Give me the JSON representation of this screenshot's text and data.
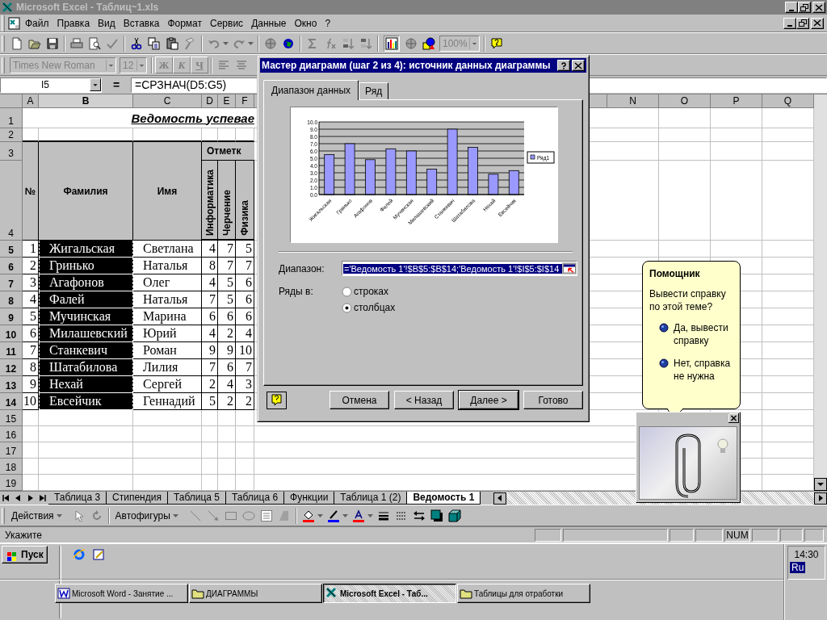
{
  "window": {
    "title": "Microsoft Excel - Таблиц~1.xls"
  },
  "menu": [
    "Файл",
    "Правка",
    "Вид",
    "Вставка",
    "Формат",
    "Сервис",
    "Данные",
    "Окно",
    "?"
  ],
  "standard_toolbar": {
    "zoom": "100%"
  },
  "formatting_toolbar": {
    "font": "Times New Roman",
    "size": "12",
    "style_buttons": [
      "Ж",
      "К",
      "Ч"
    ]
  },
  "formula_bar": {
    "name_box": "I5",
    "equals": "=",
    "formula": "=СРЗНАЧ(D5:G5)"
  },
  "sheet": {
    "columns_left": [
      {
        "label": "A",
        "selected": false
      },
      {
        "label": "B",
        "selected": true
      },
      {
        "label": "C",
        "selected": false
      },
      {
        "label": "D",
        "selected": false
      },
      {
        "label": "E",
        "selected": false
      },
      {
        "label": "F",
        "selected": false
      }
    ],
    "columns_right": [
      {
        "label": "N",
        "selected": false
      },
      {
        "label": "O",
        "selected": false
      },
      {
        "label": "P",
        "selected": false
      },
      {
        "label": "Q",
        "selected": false
      }
    ],
    "title_row": {
      "row": "1",
      "text": "Ведомость успевае"
    },
    "blank_row": "2",
    "header_rows": {
      "rows": [
        "3",
        "4"
      ],
      "number": "№",
      "surname": "Фамилия",
      "name": "Имя",
      "group": "Отметк",
      "subjects": [
        "Информатика",
        "Черчение",
        "Физика"
      ]
    },
    "rows": [
      {
        "row": "5",
        "selected": true,
        "cells": [
          "1",
          "Жигальская",
          "Светлана",
          "4",
          "7",
          "5"
        ]
      },
      {
        "row": "6",
        "selected": true,
        "cells": [
          "2",
          "Гринько",
          "Наталья",
          "8",
          "7",
          "7"
        ]
      },
      {
        "row": "7",
        "selected": true,
        "cells": [
          "3",
          "Агафонов",
          "Олег",
          "4",
          "5",
          "6"
        ]
      },
      {
        "row": "8",
        "selected": true,
        "cells": [
          "4",
          "Фалей",
          "Наталья",
          "7",
          "5",
          "6"
        ]
      },
      {
        "row": "9",
        "selected": true,
        "cells": [
          "5",
          "Мучинская",
          "Марина",
          "6",
          "6",
          "6"
        ]
      },
      {
        "row": "10",
        "selected": true,
        "cells": [
          "6",
          "Милашевский",
          "Юрий",
          "4",
          "2",
          "4"
        ]
      },
      {
        "row": "11",
        "selected": true,
        "cells": [
          "7",
          "Станкевич",
          "Роман",
          "9",
          "9",
          "10"
        ]
      },
      {
        "row": "12",
        "selected": true,
        "cells": [
          "8",
          "Шатабилова",
          "Лилия",
          "7",
          "6",
          "7"
        ]
      },
      {
        "row": "13",
        "selected": true,
        "cells": [
          "9",
          "Нехай",
          "Сергей",
          "2",
          "4",
          "3"
        ]
      },
      {
        "row": "14",
        "selected": true,
        "cells": [
          "10",
          "Евсейчик",
          "Геннадий",
          "5",
          "2",
          "2"
        ]
      }
    ],
    "empty_rows": [
      "15",
      "16",
      "17",
      "18",
      "19"
    ]
  },
  "sheet_tabs": [
    {
      "label": "Таблица 3",
      "selected": false
    },
    {
      "label": "Стипендия",
      "selected": false
    },
    {
      "label": "Таблица 5",
      "selected": false
    },
    {
      "label": "Таблица 6",
      "selected": false
    },
    {
      "label": "Функции",
      "selected": false
    },
    {
      "label": "Таблица 1 (2)",
      "selected": false
    },
    {
      "label": "Ведомость 1",
      "selected": true
    }
  ],
  "drawing_toolbar": {
    "actions": "Действия",
    "autoshapes": "Автофигуры"
  },
  "status_bar": {
    "message": "Укажите",
    "num_lock": "NUM"
  },
  "chart_wizard": {
    "title": "Мастер диаграмм (шаг 2 из 4): источник данных диаграммы",
    "tabs": [
      {
        "label": "Диапазон данных",
        "selected": true
      },
      {
        "label": "Ряд",
        "selected": false
      }
    ],
    "chart_data": {
      "type": "bar",
      "categories": [
        "Жигальская",
        "Гринько",
        "Агафонов",
        "Фалей",
        "Мучинская",
        "Милашевский",
        "Станкевич",
        "Шатабилова",
        "Нехай",
        "Евсейчик"
      ],
      "series": [
        {
          "name": "Ряд1",
          "color": "#9999ff",
          "values": [
            5.5,
            7,
            4.8,
            6.3,
            6,
            3.5,
            9,
            6.5,
            2.8,
            3.3
          ]
        }
      ],
      "grid": true,
      "ylim": [
        0,
        10
      ],
      "yticks": [
        {
          "value": 0,
          "label": "0.0"
        },
        {
          "value": 1,
          "label": "1.0"
        },
        {
          "value": 2,
          "label": "2.0"
        },
        {
          "value": 3,
          "label": "3.0"
        },
        {
          "value": 4,
          "label": "4.0"
        },
        {
          "value": 5,
          "label": "5.0"
        },
        {
          "value": 6,
          "label": "6.0"
        },
        {
          "value": 7,
          "label": "7.0"
        },
        {
          "value": 8,
          "label": "8.0"
        },
        {
          "value": 9,
          "label": "9.0"
        },
        {
          "value": 10,
          "label": "10.0"
        }
      ]
    },
    "range_label": "Диапазон:",
    "range": "='Ведомость 1'!$B$5:$B$14;'Ведомость 1'!$I$5:$I$14",
    "series_in_label": "Ряды в:",
    "series_in": [
      {
        "label": "строках",
        "selected": false
      },
      {
        "label": "столбцах",
        "selected": true
      }
    ],
    "buttons": [
      {
        "label": "Отмена",
        "default": false
      },
      {
        "label": "< Назад",
        "default": false
      },
      {
        "label": "Далее >",
        "default": true
      },
      {
        "label": "Готово",
        "default": false
      }
    ]
  },
  "assistant": {
    "title": "Помощник",
    "question": "Вывести справку по этой теме?",
    "options": [
      "Да, вывести справку",
      "Нет, справка не нужна"
    ]
  },
  "taskbar": {
    "start": "Пуск",
    "tasks": [
      {
        "label": "Microsoft Word - Занятие ...",
        "kind": "word",
        "selected": false
      },
      {
        "label": "ДИАГРАММЫ",
        "kind": "folder",
        "selected": false
      },
      {
        "label": "Microsoft Excel - Таб...",
        "kind": "excel",
        "selected": true
      },
      {
        "label": "Таблицы для отработки",
        "kind": "folder",
        "selected": false
      }
    ],
    "clock": "14:30",
    "language": "Ru"
  }
}
